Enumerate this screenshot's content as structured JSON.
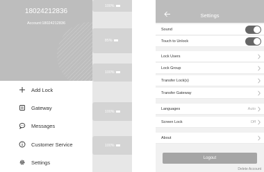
{
  "drawer": {
    "phone": "18024212836",
    "account": "Account:18024212836",
    "menu": [
      {
        "icon": "plus-icon",
        "label": "Add Lock"
      },
      {
        "icon": "gateway-icon",
        "label": "Gateway"
      },
      {
        "icon": "message-icon",
        "label": "Messages"
      },
      {
        "icon": "info-icon",
        "label": "Customer Service"
      },
      {
        "icon": "gear-icon",
        "label": "Settings"
      }
    ]
  },
  "background_list": {
    "cards": [
      {
        "percent": "100%"
      },
      {
        "percent": "85%"
      },
      {
        "percent": "100%"
      },
      {
        "percent": "100%"
      },
      {
        "percent": "100%"
      }
    ]
  },
  "settings": {
    "title": "Settings",
    "toggles": [
      {
        "label": "Sound",
        "on": true
      },
      {
        "label": "Touch to Unlock",
        "on": true
      }
    ],
    "lock_group": [
      {
        "label": "Lock Users"
      },
      {
        "label": "Lock Group"
      },
      {
        "label": "Transfer Lock(s)"
      },
      {
        "label": "Transfer Gateway"
      }
    ],
    "prefs": [
      {
        "label": "Languages",
        "value": "Auto"
      },
      {
        "label": "Screen Lock",
        "value": "Off"
      }
    ],
    "about_label": "About",
    "logout_label": "Logout",
    "delete_account_label": "Delete Account"
  },
  "colors": {
    "header_gray": "#bcbcbc",
    "toggle_on": "#666666",
    "logout_button": "#a5a5a5"
  }
}
